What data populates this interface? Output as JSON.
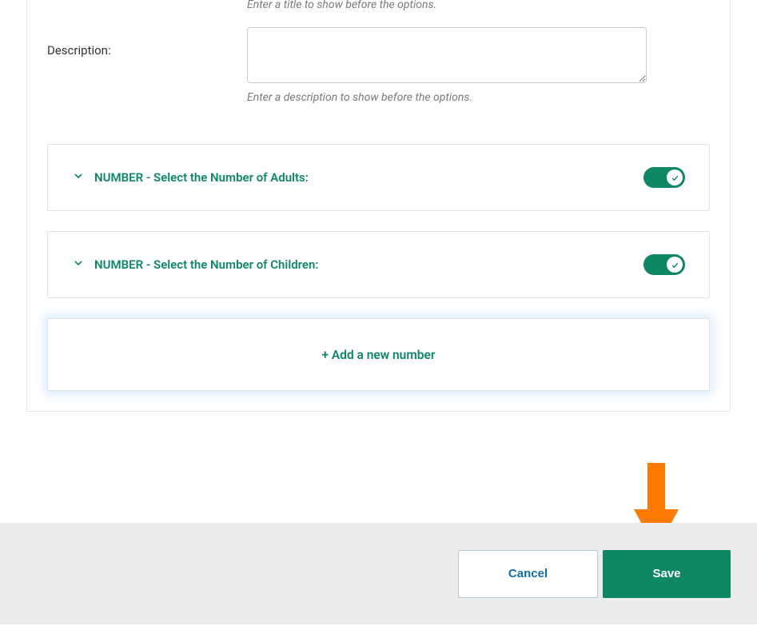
{
  "fields": {
    "title_help": "Enter a title to show before the options.",
    "description_label": "Description:",
    "description_value": "",
    "description_help": "Enter a description to show before the options."
  },
  "panels": [
    {
      "label": "NUMBER - Select the Number of Adults:",
      "enabled": true
    },
    {
      "label": "NUMBER - Select the Number of Children:",
      "enabled": true
    }
  ],
  "add_button_label": "+  Add a new number",
  "footer": {
    "cancel_label": "Cancel",
    "save_label": "Save"
  },
  "colors": {
    "accent": "#0e8864",
    "arrow": "#ff7a00",
    "link": "#0f6fa8"
  }
}
